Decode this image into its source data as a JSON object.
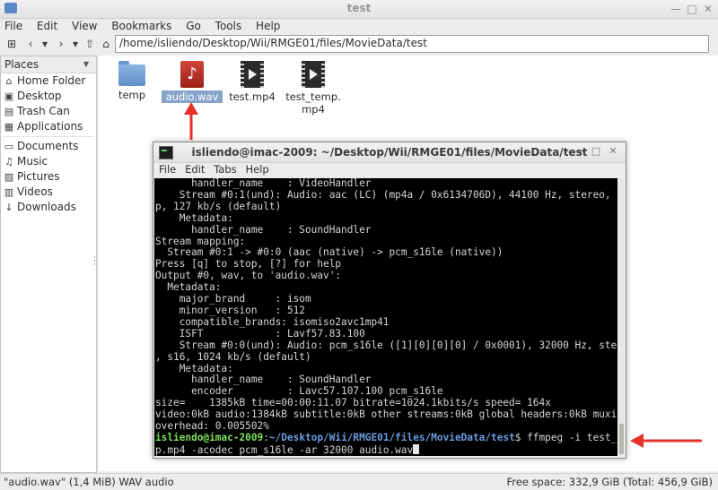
{
  "window": {
    "title": "test"
  },
  "menu": [
    "File",
    "Edit",
    "View",
    "Bookmarks",
    "Go",
    "Tools",
    "Help"
  ],
  "toolbar": {
    "path": "/home/isliendo/Desktop/Wii/RMGE01/files/MovieData/test"
  },
  "sidebar": {
    "header": "Places",
    "items": [
      {
        "label": "Home Folder",
        "icon": "home-icon"
      },
      {
        "label": "Desktop",
        "icon": "desktop-icon"
      },
      {
        "label": "Trash Can",
        "icon": "trash-icon"
      },
      {
        "label": "Applications",
        "icon": "applications-icon"
      },
      {
        "label": "Documents",
        "icon": "documents-icon"
      },
      {
        "label": "Music",
        "icon": "music-icon"
      },
      {
        "label": "Pictures",
        "icon": "pictures-icon"
      },
      {
        "label": "Videos",
        "icon": "videos-icon"
      },
      {
        "label": "Downloads",
        "icon": "downloads-icon"
      }
    ]
  },
  "files": [
    {
      "name": "temp",
      "type": "folder"
    },
    {
      "name": "audio.wav",
      "type": "audio",
      "selected": true
    },
    {
      "name": "test.mp4",
      "type": "video"
    },
    {
      "name": "test_temp.\nmp4",
      "type": "video"
    }
  ],
  "terminal": {
    "title": "isliendo@imac-2009: ~/Desktop/Wii/RMGE01/files/MovieData/test",
    "menu": [
      "File",
      "Edit",
      "Tabs",
      "Help"
    ],
    "lines": [
      "      handler_name    : VideoHandler",
      "    Stream #0:1(und): Audio: aac (LC) (mp4a / 0x6134706D), 44100 Hz, stereo, flt",
      "p, 127 kb/s (default)",
      "    Metadata:",
      "      handler_name    : SoundHandler",
      "Stream mapping:",
      "  Stream #0:1 -> #0:0 (aac (native) -> pcm_s16le (native))",
      "Press [q] to stop, [?] for help",
      "Output #0, wav, to 'audio.wav':",
      "  Metadata:",
      "    major_brand     : isom",
      "    minor_version   : 512",
      "    compatible_brands: isomiso2avc1mp41",
      "    ISFT            : Lavf57.83.100",
      "    Stream #0:0(und): Audio: pcm_s16le ([1][0][0][0] / 0x0001), 32000 Hz, stereo",
      ", s16, 1024 kb/s (default)",
      "    Metadata:",
      "      handler_name    : SoundHandler",
      "      encoder         : Lavc57.107.100 pcm_s16le",
      "size=    1385kB time=00:00:11.07 bitrate=1024.1kbits/s speed= 164x",
      "video:0kB audio:1384kB subtitle:0kB other streams:0kB global headers:0kB muxing",
      "overhead: 0.005502%"
    ],
    "prompt_user": "isliendo@imac-2009",
    "prompt_sep": ":",
    "prompt_path": "~/Desktop/Wii/RMGE01/files/MovieData/test",
    "prompt_symbol": "$ ",
    "command_line1": "ffmpeg -i test_tem",
    "command_line2": "p.mp4 -acodec pcm_s16le -ar 32000 audio.wav"
  },
  "status": {
    "left": "\"audio.wav\" (1,4 MiB) WAV audio",
    "right": "Free space: 332,9 GiB (Total: 456,9 GiB)"
  },
  "colors": {
    "arrow": "#e8302a",
    "selection": "#86a3c9",
    "terminal_bg": "#000000",
    "prompt_user": "#7fe05b",
    "prompt_path": "#6a9be0"
  }
}
